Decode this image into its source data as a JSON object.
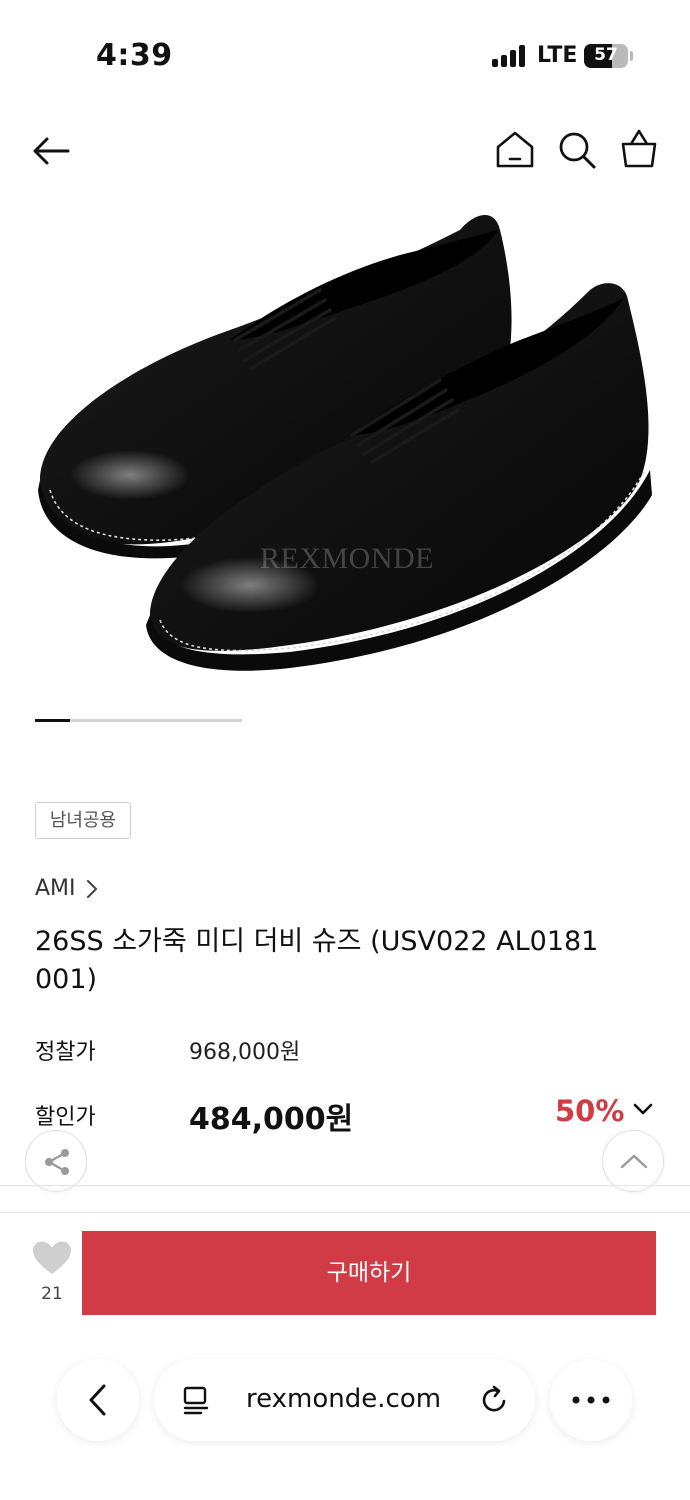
{
  "status_bar": {
    "time": "4:39",
    "network": "LTE",
    "battery": "57"
  },
  "header": {
    "icons": [
      "back-arrow-icon",
      "home-icon",
      "search-icon",
      "shopping-bag-icon"
    ]
  },
  "product_image": {
    "watermark": "REXMONDE",
    "carousel_progress": 0.17
  },
  "product": {
    "gender_badge": "남녀공용",
    "brand": "AMI",
    "brand_chevron": ">",
    "title": "26SS 소가죽 미디 더비 슈즈 (USV022 AL0181 001)",
    "list_price_label": "정찰가",
    "list_price": "968,000원",
    "sale_price_label": "할인가",
    "sale_price": "484,000원",
    "discount_rate": "50%"
  },
  "floating": {
    "share_icon": "share-icon",
    "top_icon": "chevron-up-icon"
  },
  "purchase_bar": {
    "like_count": "21",
    "buy_label": "구매하기"
  },
  "browser_toolbar": {
    "url": "rexmonde.com"
  },
  "colors": {
    "accent": "#d03b46",
    "text": "#111111",
    "badge_border": "#cfcfcf"
  }
}
